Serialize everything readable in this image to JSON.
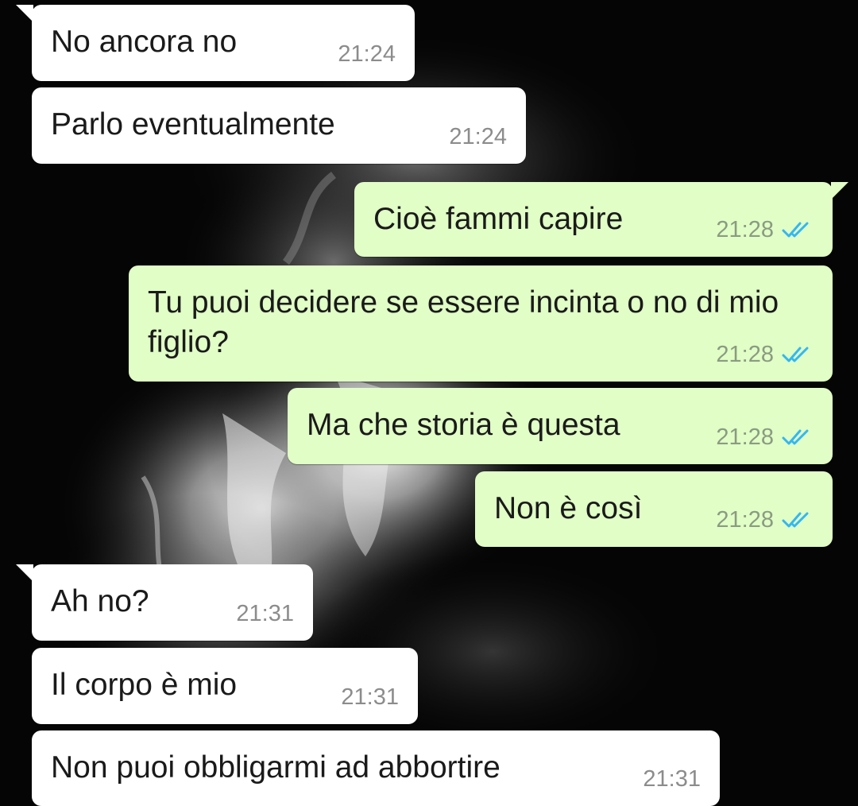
{
  "colors": {
    "incoming_bubble": "#ffffff",
    "outgoing_bubble": "#e1fec6",
    "timestamp": "#8c8c8c",
    "read_ticks": "#34b7f1",
    "wallpaper": "#050505"
  },
  "wallpaper": {
    "description": "dark monochrome photo of a burning fire"
  },
  "messages": [
    {
      "direction": "in",
      "text": "No ancora no",
      "time": "21:24"
    },
    {
      "direction": "in",
      "text": "Parlo eventualmente",
      "time": "21:24"
    },
    {
      "direction": "out",
      "text": "Cioè fammi capire",
      "time": "21:28",
      "status_icon": "double-check-read-icon"
    },
    {
      "direction": "out",
      "text": "Tu puoi decidere se essere incinta o no di mio figlio?",
      "time": "21:28",
      "status_icon": "double-check-read-icon"
    },
    {
      "direction": "out",
      "text": "Ma che storia è questa",
      "time": "21:28",
      "status_icon": "double-check-read-icon"
    },
    {
      "direction": "out",
      "text": "Non è così",
      "time": "21:28",
      "status_icon": "double-check-read-icon"
    },
    {
      "direction": "in",
      "text": "Ah no?",
      "time": "21:31"
    },
    {
      "direction": "in",
      "text": "Il corpo è mio",
      "time": "21:31"
    },
    {
      "direction": "in",
      "text": "Non puoi obbligarmi ad abbortire",
      "time": "21:31"
    }
  ]
}
